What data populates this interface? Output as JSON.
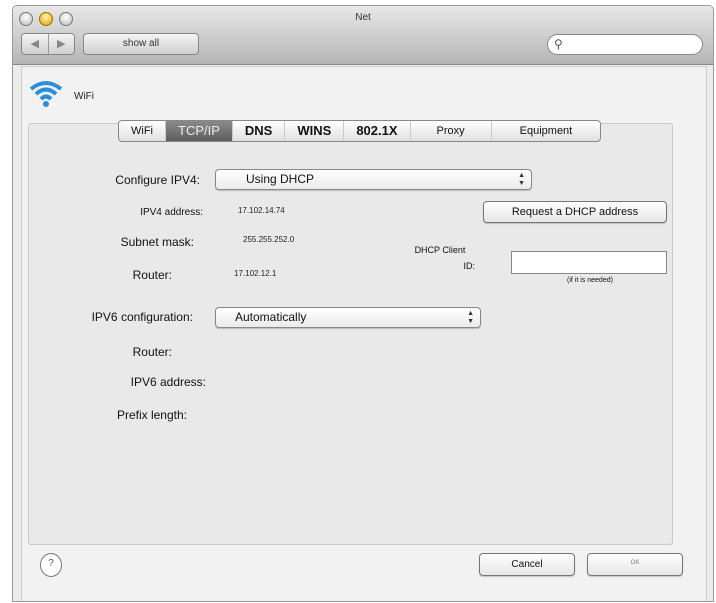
{
  "window": {
    "title": "Net"
  },
  "toolbar": {
    "back": "◀",
    "forward": "▶",
    "show_all": "show all",
    "search_placeholder": ""
  },
  "service": {
    "name": "WiFi"
  },
  "tabs": [
    {
      "label": "WiFi",
      "active": false
    },
    {
      "label": "TCP/IP",
      "active": true
    },
    {
      "label": "DNS",
      "active": false
    },
    {
      "label": "WINS",
      "active": false
    },
    {
      "label": "802.1X",
      "active": false
    },
    {
      "label": "Proxy",
      "active": false
    },
    {
      "label": "Equipment",
      "active": false
    }
  ],
  "form": {
    "configure_ipv4_label": "Configure IPV4:",
    "configure_ipv4_value": "Using DHCP",
    "ipv4_address_label": "IPV4 address:",
    "ipv4_address_value": "17.102.14.74",
    "subnet_mask_label": "Subnet mask:",
    "subnet_mask_value": "255.255.252.0",
    "router_label": "Router:",
    "router_value": "17.102.12.1",
    "request_dhcp_button": "Request a DHCP address",
    "dhcp_client_label_1": "DHCP Client",
    "dhcp_client_label_2": "ID:",
    "dhcp_client_value": "",
    "dhcp_client_hint": "(if it is needed)",
    "ipv6_config_label": "IPV6 configuration:",
    "ipv6_config_value": "Automatically",
    "ipv6_router_label": "Router:",
    "ipv6_address_label": "IPV6 address:",
    "prefix_length_label": "Prefix length:"
  },
  "footer": {
    "help": "?",
    "cancel": "Cancel",
    "ok": "OK"
  },
  "colors": {
    "active_tab": "#6e6e6e",
    "minimize_light": "#e0a000",
    "wifi_icon": "#2a8fd8"
  }
}
